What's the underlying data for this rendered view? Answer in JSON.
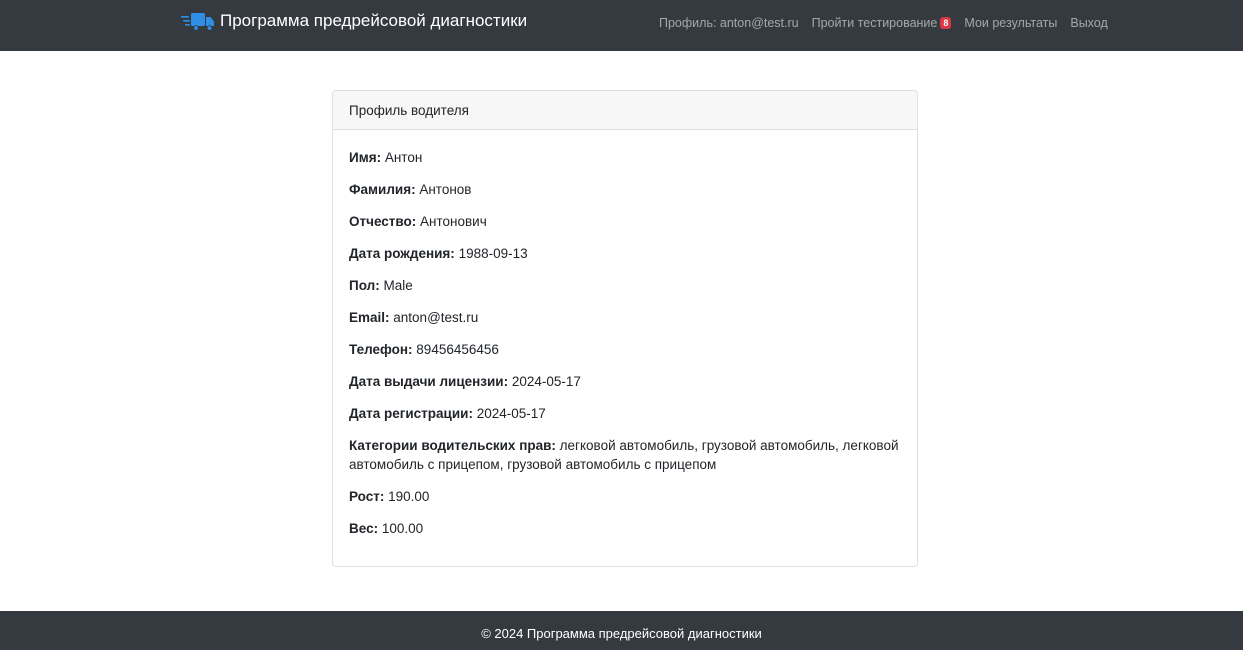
{
  "navbar": {
    "brand_icon": "truck-icon",
    "brand_title": "Программа предрейсовой диагностики",
    "links": [
      {
        "label": "Профиль: anton@test.ru"
      },
      {
        "label": "Пройти тестирование",
        "badge": "8"
      },
      {
        "label": "Мои результаты"
      },
      {
        "label": "Выход"
      }
    ]
  },
  "colors": {
    "navbar_bg": "#343a40",
    "badge": "#dc3545",
    "brand_icon": "#2f8fe6"
  },
  "profile": {
    "title": "Профиль водителя",
    "fields": [
      {
        "label": "Имя:",
        "value": "Антон"
      },
      {
        "label": "Фамилия:",
        "value": "Антонов"
      },
      {
        "label": "Отчество:",
        "value": "Антонович"
      },
      {
        "label": "Дата рождения:",
        "value": "1988-09-13"
      },
      {
        "label": "Пол:",
        "value": "Male"
      },
      {
        "label": "Email:",
        "value": "anton@test.ru"
      },
      {
        "label": "Телефон:",
        "value": "89456456456"
      },
      {
        "label": "Дата выдачи лицензии:",
        "value": "2024-05-17"
      },
      {
        "label": "Дата регистрации:",
        "value": "2024-05-17"
      },
      {
        "label": "Категории водительских прав:",
        "value": "легковой автомобиль, грузовой автомобиль, легковой автомобиль с прицепом, грузовой автомобиль с прицепом"
      },
      {
        "label": "Рост:",
        "value": "190.00"
      },
      {
        "label": "Вес:",
        "value": "100.00"
      }
    ]
  },
  "footer": {
    "text": "© 2024 Программа предрейсовой диагностики"
  }
}
